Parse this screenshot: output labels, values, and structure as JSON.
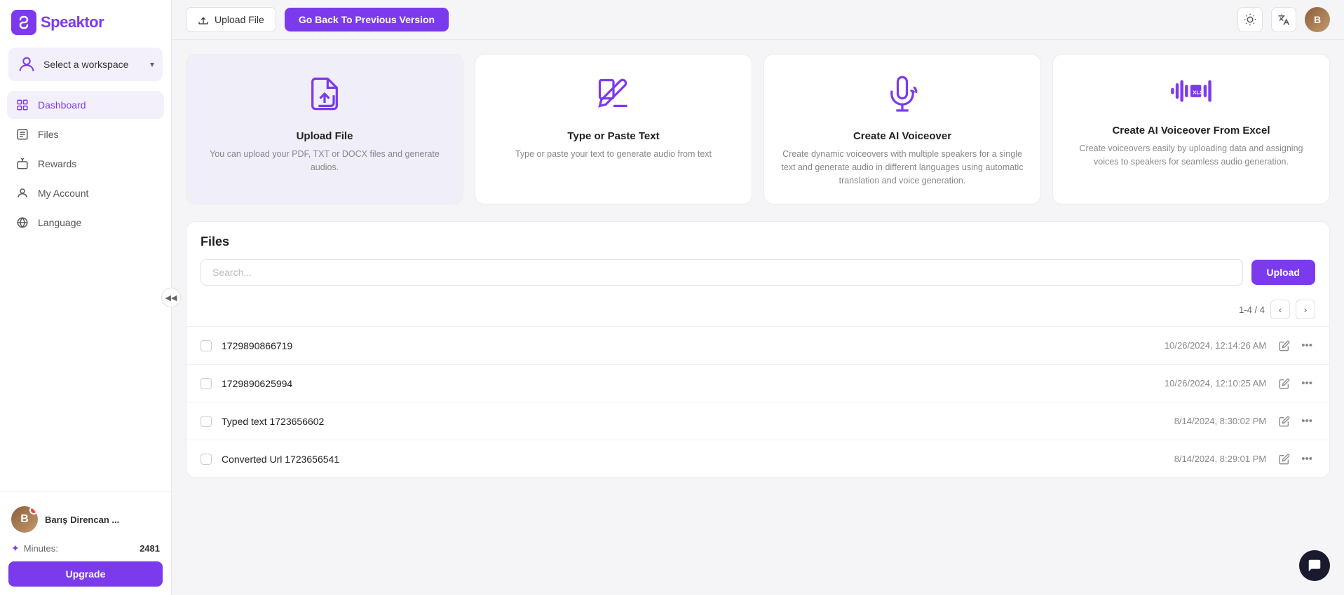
{
  "app": {
    "name": "Speaktor",
    "logo_letter": "S"
  },
  "sidebar": {
    "workspace": {
      "label": "Select a workspace",
      "chevron": "▾"
    },
    "nav_items": [
      {
        "id": "dashboard",
        "label": "Dashboard",
        "active": true,
        "icon": "dashboard"
      },
      {
        "id": "files",
        "label": "Files",
        "active": false,
        "icon": "files"
      },
      {
        "id": "rewards",
        "label": "Rewards",
        "active": false,
        "icon": "rewards"
      },
      {
        "id": "my-account",
        "label": "My Account",
        "active": false,
        "icon": "account"
      },
      {
        "id": "language",
        "label": "Language",
        "active": false,
        "icon": "language"
      }
    ],
    "user": {
      "name": "Barış Direncan ...",
      "minutes_label": "Minutes:",
      "minutes_value": "2481"
    },
    "upgrade_label": "Upgrade"
  },
  "topbar": {
    "upload_file_label": "Upload File",
    "go_back_label": "Go Back To Previous Version",
    "search_placeholder": "Search..."
  },
  "cards": [
    {
      "id": "upload-file",
      "title": "Upload File",
      "desc": "You can upload your PDF, TXT or DOCX files and generate audios.",
      "icon": "upload-file"
    },
    {
      "id": "type-paste",
      "title": "Type or Paste Text",
      "desc": "Type or paste your text to generate audio from text",
      "icon": "type-paste"
    },
    {
      "id": "ai-voiceover",
      "title": "Create AI Voiceover",
      "desc": "Create dynamic voiceovers with multiple speakers for a single text and generate audio in different languages using automatic translation and voice generation.",
      "icon": "ai-voiceover"
    },
    {
      "id": "excel-voiceover",
      "title": "Create AI Voiceover From Excel",
      "desc": "Create voiceovers easily by uploading data and assigning voices to speakers for seamless audio generation.",
      "icon": "excel-voiceover"
    }
  ],
  "files_section": {
    "title": "Files",
    "search_placeholder": "Search...",
    "upload_label": "Upload",
    "pagination": "1-4 / 4",
    "files": [
      {
        "id": 1,
        "name": "1729890866719",
        "date": "10/26/2024, 12:14:26 AM"
      },
      {
        "id": 2,
        "name": "1729890625994",
        "date": "10/26/2024, 12:10:25 AM"
      },
      {
        "id": 3,
        "name": "Typed text 1723656602",
        "date": "8/14/2024, 8:30:02 PM"
      },
      {
        "id": 4,
        "name": "Converted Url 1723656541",
        "date": "8/14/2024, 8:29:01 PM"
      }
    ]
  }
}
